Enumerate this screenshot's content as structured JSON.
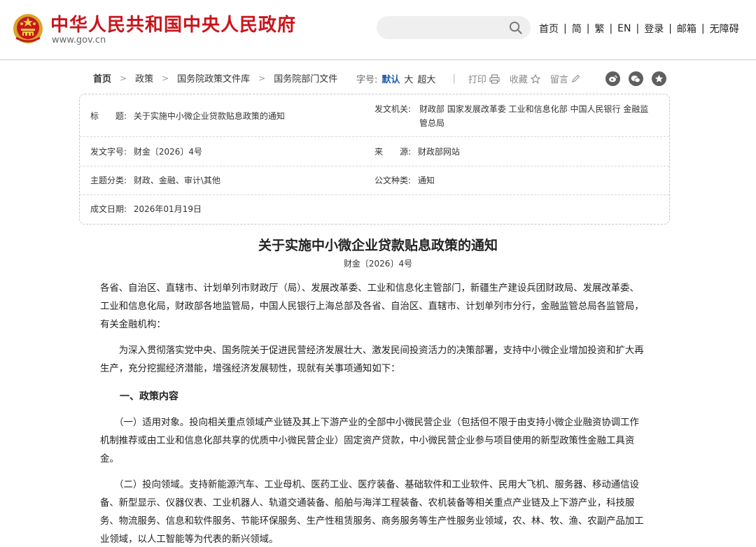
{
  "header": {
    "site_title": "中华人民共和国中央人民政府",
    "site_url": "www.gov.cn",
    "search_placeholder": "",
    "nav": [
      "首页",
      "简",
      "繁",
      "EN",
      "登录",
      "邮箱",
      "无障碍"
    ],
    "nav_sep": "|"
  },
  "breadcrumb": {
    "items": [
      "首页",
      "政策",
      "国务院政策文件库",
      "国务院部门文件"
    ],
    "arrow": ">"
  },
  "toolbar": {
    "font_label": "字号:",
    "font_sizes": [
      "默认",
      "大",
      "超大"
    ],
    "active_font": "默认",
    "print": "打印",
    "favorite": "收藏",
    "comment": "留言",
    "share_icons": [
      "weibo-icon",
      "wechat-icon",
      "qzone-icon"
    ]
  },
  "meta": {
    "title_label": "标　　题:",
    "title_value": "关于实施中小微企业贷款贴息政策的通知",
    "issuer_label": "发文机关:",
    "issuer_value_1": "财政部 国家发展改革委 工业和信息化部 中国人民银行 金融监",
    "issuer_value_2": "管总局",
    "docno_label": "发文字号:",
    "docno_value": "财金〔2026〕4号",
    "source_label": "来　　源:",
    "source_value": "财政部网站",
    "topic_label": "主题分类:",
    "topic_value": "财政、金融、审计\\其他",
    "type_label": "公文种类:",
    "type_value": "通知",
    "date_label": "成文日期:",
    "date_value": "2026年01月19日"
  },
  "article": {
    "title": "关于实施中小微企业贷款贴息政策的通知",
    "doc_number": "财金〔2026〕4号",
    "addressee": [
      "各省、自治区、直辖市、计划单列市财政厅（局）、发展改革委、工业和信息化主管部门，新疆生产建设兵团财政局、发展改革委、",
      "工业和信息化局，财政部各地监管局，中国人民银行上海总部及各省、自治区、直辖市、计划单列市分行，金融监管总局各监管局，",
      "有关金融机构："
    ],
    "intro": [
      "　　为深入贯彻落实党中央、国务院关于促进民营经济发展壮大、激发民间投资活力的决策部署，支持中小微企业增加投资和扩大再",
      "生产，充分挖掘经济潜能，增强经济发展韧性，现就有关事项通知如下："
    ],
    "section1": "一、政策内容",
    "item1": [
      "　　（一）适用对象。投向相关重点领域产业链及其上下游产业的全部中小微民营企业（包括但不限于由支持小微企业融资协调工作",
      "机制推荐或由工业和信息化部共享的优质中小微民营企业）固定资产贷款，中小微民营企业参与项目使用的新型政策性金融工具资",
      "金。"
    ],
    "item2": [
      "　　（二）投向领域。支持新能源汽车、工业母机、医药工业、医疗装备、基础软件和工业软件、民用大飞机、服务器、移动通信设",
      "备、新型显示、仪器仪表、工业机器人、轨道交通装备、船舶与海洋工程装备、农机装备等相关重点产业链及上下游产业，科技服",
      "务、物流服务、信息和软件服务、节能环保服务、生产性租赁服务、商务服务等生产性服务业领域，农、林、牧、渔、农副产品加工",
      "业领域，以人工智能等为代表的新兴领域。"
    ]
  }
}
